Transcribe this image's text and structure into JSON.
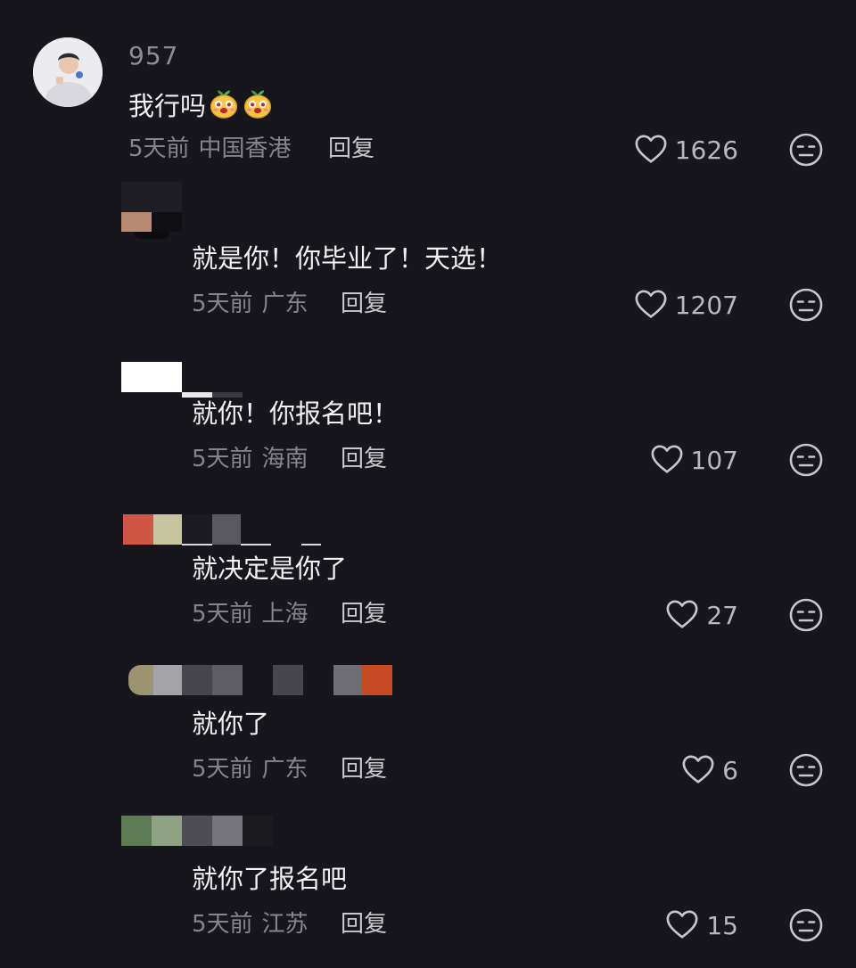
{
  "colors": {
    "background": "#17161c",
    "text_primary": "#f1f1f3",
    "text_secondary": "#86858b",
    "reply_text": "#c9c8cd"
  },
  "icons": {
    "like": "heart-outline-icon",
    "dislike": "neutral-face-icon",
    "emoji": "sprout-face-emoji"
  },
  "top_comment": {
    "username": "957",
    "text": "我行吗",
    "time": "5天前",
    "region": "中国香港",
    "reply_label": "回复",
    "likes": "1626"
  },
  "replies": [
    {
      "text": "就是你！你毕业了！天选！",
      "time": "5天前",
      "region": "广东",
      "reply_label": "回复",
      "likes": "1207"
    },
    {
      "text": "就你！你报名吧！",
      "time": "5天前",
      "region": "海南",
      "reply_label": "回复",
      "likes": "107"
    },
    {
      "text": "就决定是你了",
      "time": "5天前",
      "region": "上海",
      "reply_label": "回复",
      "likes": "27"
    },
    {
      "text": "就你了",
      "time": "5天前",
      "region": "广东",
      "reply_label": "回复",
      "likes": "6"
    },
    {
      "text": "就你了报名吧",
      "time": "5天前",
      "region": "江苏",
      "reply_label": "回复",
      "likes": "15"
    }
  ]
}
